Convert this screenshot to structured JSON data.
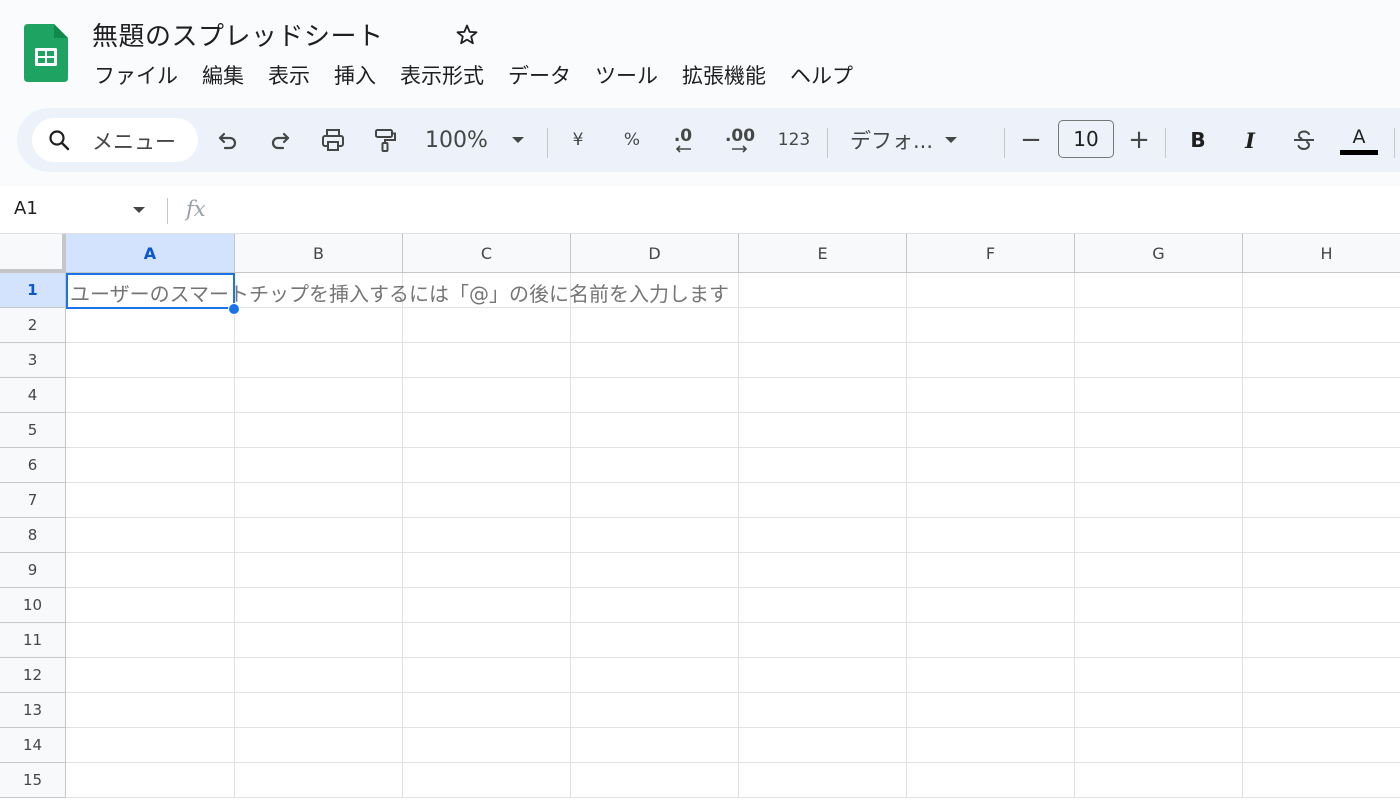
{
  "document": {
    "title": "無題のスプレッドシート"
  },
  "menu": [
    "ファイル",
    "編集",
    "表示",
    "挿入",
    "表示形式",
    "データ",
    "ツール",
    "拡張機能",
    "ヘルプ"
  ],
  "toolbar": {
    "search_label": "メニュー",
    "zoom": "100%",
    "currency": "¥",
    "percent": "%",
    "decrease_decimal": ".0",
    "increase_decimal": ".00",
    "number_format": "123",
    "font": "デフォ...",
    "font_size": "10",
    "minus": "−",
    "plus": "+",
    "bold": "B",
    "italic": "I",
    "text_color_letter": "A"
  },
  "formula_bar": {
    "cell_ref": "A1",
    "fx": "fx",
    "value": ""
  },
  "grid": {
    "columns": [
      "A",
      "B",
      "C",
      "D",
      "E",
      "F",
      "G",
      "H"
    ],
    "rows": [
      "1",
      "2",
      "3",
      "4",
      "5",
      "6",
      "7",
      "8",
      "9",
      "10",
      "11",
      "12",
      "13",
      "14",
      "15"
    ],
    "active_cell": "A1",
    "cell_hint": "ユーザーのスマートチップを挿入するには「@」の後に名前を入力します"
  },
  "colors": {
    "accent": "#1a73e8",
    "sheets_green": "#1ea362",
    "toolbar_bg": "#edf2fa",
    "active_header": "#d3e3fd"
  }
}
